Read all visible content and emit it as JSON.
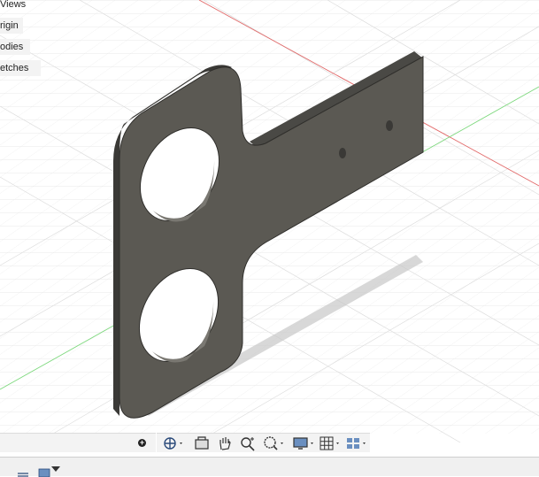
{
  "browser": {
    "items": [
      {
        "label": "Views"
      },
      {
        "label": "rigin"
      },
      {
        "label": "odies"
      },
      {
        "label": "etches"
      }
    ]
  },
  "toolbar": {
    "tools": [
      {
        "icon": "orbit-icon"
      },
      {
        "icon": "look-at-icon"
      },
      {
        "icon": "pan-icon"
      },
      {
        "icon": "zoom-icon"
      },
      {
        "icon": "zoom-window-icon"
      },
      {
        "icon": "display-settings-icon"
      },
      {
        "icon": "grid-settings-icon"
      },
      {
        "icon": "viewports-icon"
      }
    ]
  },
  "colors": {
    "part": "#5b5953",
    "part_edge": "#2f2e2b",
    "grid": "#d9d9d9",
    "x_axis": "#e26a6a",
    "y_axis": "#7dd87d",
    "toolbar_bg": "#f3f3f3"
  }
}
